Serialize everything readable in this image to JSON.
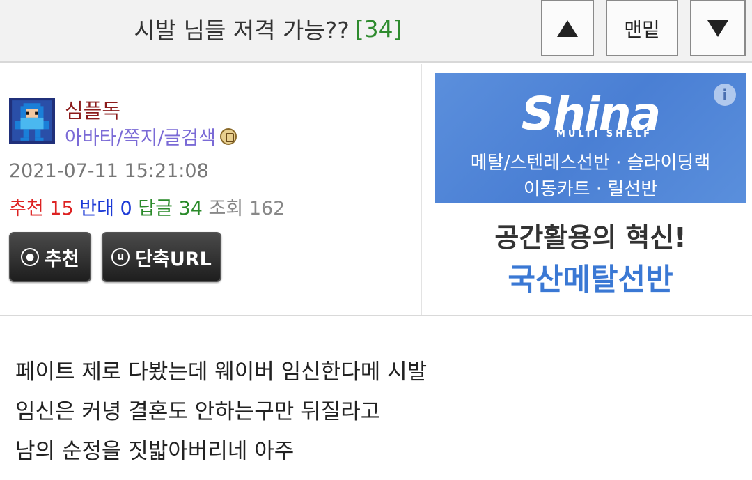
{
  "header": {
    "title": "시발 님들 저격 가능??",
    "reply_count": "[34]",
    "bottom_label": "맨밑",
    "up_icon": "triangle-up-icon",
    "down_icon": "triangle-down-icon"
  },
  "author": {
    "nickname": "심플독",
    "links": "아바타/쪽지/글검색",
    "avatar_icon": "megaman-avatar-icon"
  },
  "post": {
    "date": "2021-07-11 15:21:08",
    "recommend_label": "추천",
    "recommend_value": "15",
    "oppose_label": "반대",
    "oppose_value": "0",
    "reply_label": "답글",
    "reply_value": "34",
    "view_label": "조회",
    "view_value": "162"
  },
  "buttons": {
    "recommend": "추천",
    "short_url": "단축URL"
  },
  "ad": {
    "logo": "Shina",
    "sub": "MULTI SHELF",
    "line1": "메탈/스텐레스선반 · 슬라이딩랙",
    "line2": "이동카트 · 릴선반",
    "headline1": "공간활용의 혁신!",
    "headline2": "국산메탈선반",
    "info_glyph": "i"
  },
  "content": {
    "lines": [
      "페이트 제로 다봤는데 웨이버 임신한다메 시발",
      "임신은 커녕 결혼도 안하는구만 뒤질라고",
      "남의 순정을 짓밟아버리네 아주"
    ]
  },
  "colors": {
    "reply_count": "#2e8b2e",
    "nickname": "#8b1a1a",
    "links": "#7a6ad6",
    "recommend": "#dd2222",
    "oppose": "#1c3ad6",
    "reply": "#2a8a2a",
    "ad_blue": "#4a7fd4"
  }
}
